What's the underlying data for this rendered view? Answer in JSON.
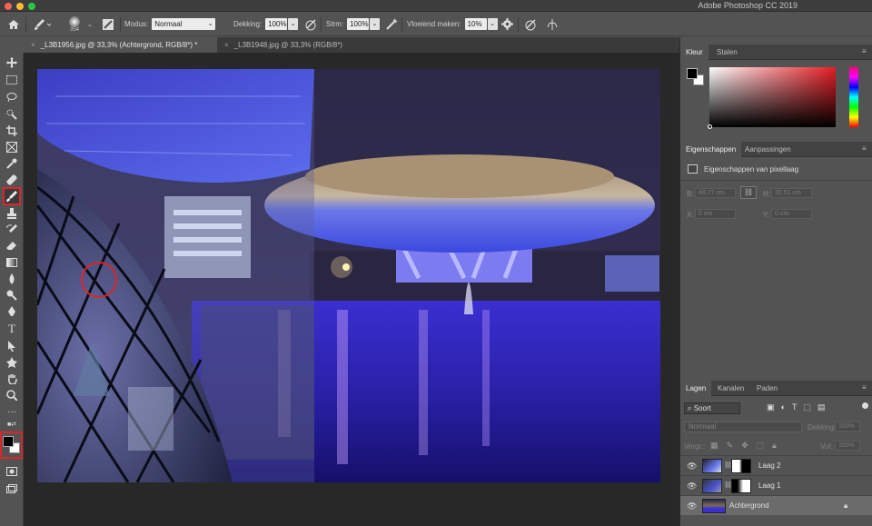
{
  "app": {
    "title": "Adobe Photoshop CC 2019"
  },
  "options": {
    "brush_size": "354",
    "mode_label": "Modus:",
    "mode_value": "Normaal",
    "opacity_label": "Dekking:",
    "opacity_value": "100%",
    "flow_label": "Strm:",
    "flow_value": "100%",
    "smoothing_label": "Vloeiend maken:",
    "smoothing_value": "10%"
  },
  "tabs": [
    {
      "label": "_L3B1956.jpg @ 33,3% (Achtergrond, RGB/8*) *",
      "close": "×"
    },
    {
      "label": "_L3B1948.jpg @ 33,3% (RGB/8*)",
      "close": "×"
    }
  ],
  "color_panel": {
    "tabs": [
      "Kleur",
      "Stalen"
    ]
  },
  "properties_panel": {
    "tabs": [
      "Eigenschappen",
      "Aanpassingen"
    ],
    "subtitle": "Eigenschappen van pixellaag",
    "w_label": "B:",
    "w_value": "48,77 cm",
    "h_label": "H:",
    "h_value": "32,51 cm",
    "x_label": "X:",
    "x_value": "0 cm",
    "y_label": "Y:",
    "y_value": "0 cm"
  },
  "layers_panel": {
    "tabs": [
      "Lagen",
      "Kanalen",
      "Paden"
    ],
    "filter_label": "Soort",
    "blend_mode": "Normaal",
    "opacity_label": "Dekking:",
    "opacity_value": "100%",
    "lock_label": "Vergr.:",
    "fill_label": "Vul:",
    "fill_value": "100%",
    "layers": [
      {
        "name": "Laag 2"
      },
      {
        "name": "Laag 1"
      },
      {
        "name": "Achtergrond"
      }
    ]
  },
  "colors": {
    "accent_red": "#d8262d",
    "panel_bg": "#535353",
    "canvas_bg": "#282828"
  }
}
